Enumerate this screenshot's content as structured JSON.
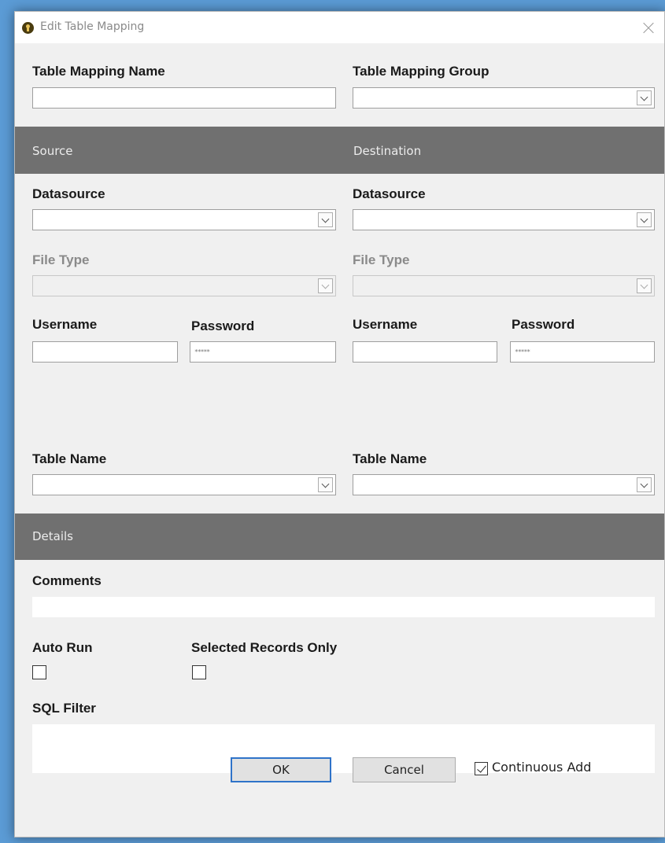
{
  "window": {
    "title": "Edit Table Mapping"
  },
  "header": {
    "mapping_name_label": "Table Mapping Name",
    "mapping_name_value": "",
    "mapping_group_label": "Table Mapping Group",
    "mapping_group_value": ""
  },
  "bands": {
    "source": "Source",
    "destination": "Destination",
    "details": "Details"
  },
  "source": {
    "datasource_label": "Datasource",
    "filetype_label": "File Type",
    "username_label": "Username",
    "password_label": "Password",
    "password_mask": "*****",
    "tablename_label": "Table Name"
  },
  "destination": {
    "datasource_label": "Datasource",
    "filetype_label": "File Type",
    "username_label": "Username",
    "password_label": "Password",
    "password_mask": "*****",
    "tablename_label": "Table Name"
  },
  "details": {
    "comments_label": "Comments",
    "auto_run_label": "Auto Run",
    "auto_run_checked": false,
    "selected_only_label": "Selected Records Only",
    "selected_only_checked": false,
    "sql_filter_label": "SQL Filter"
  },
  "footer": {
    "ok_label": "OK",
    "cancel_label": "Cancel",
    "continuous_add_label": "Continuous Add",
    "continuous_add_checked": true
  }
}
